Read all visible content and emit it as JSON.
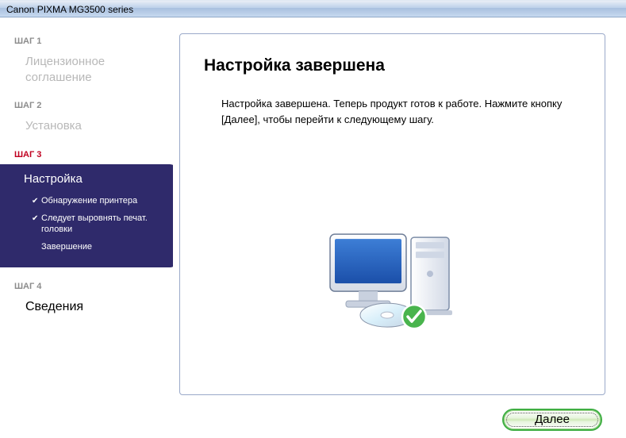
{
  "titlebar": "Canon PIXMA MG3500 series",
  "steps": [
    {
      "label": "ШАГ 1",
      "title": "Лицензионное соглашение"
    },
    {
      "label": "ШАГ 2",
      "title": "Установка"
    },
    {
      "label": "ШАГ 3",
      "title": "Настройка",
      "subitems": [
        {
          "done": true,
          "text": "Обнаружение принтера"
        },
        {
          "done": true,
          "text": "Следует выровнять печат. головки"
        },
        {
          "done": false,
          "text": "Завершение"
        }
      ]
    },
    {
      "label": "ШАГ 4",
      "title": "Сведения"
    }
  ],
  "main": {
    "heading": "Настройка завершена",
    "body": "Настройка завершена. Теперь продукт готов к работе. Нажмите кнопку [Далее], чтобы перейти к следующему шагу."
  },
  "footer": {
    "next": "Далее"
  }
}
